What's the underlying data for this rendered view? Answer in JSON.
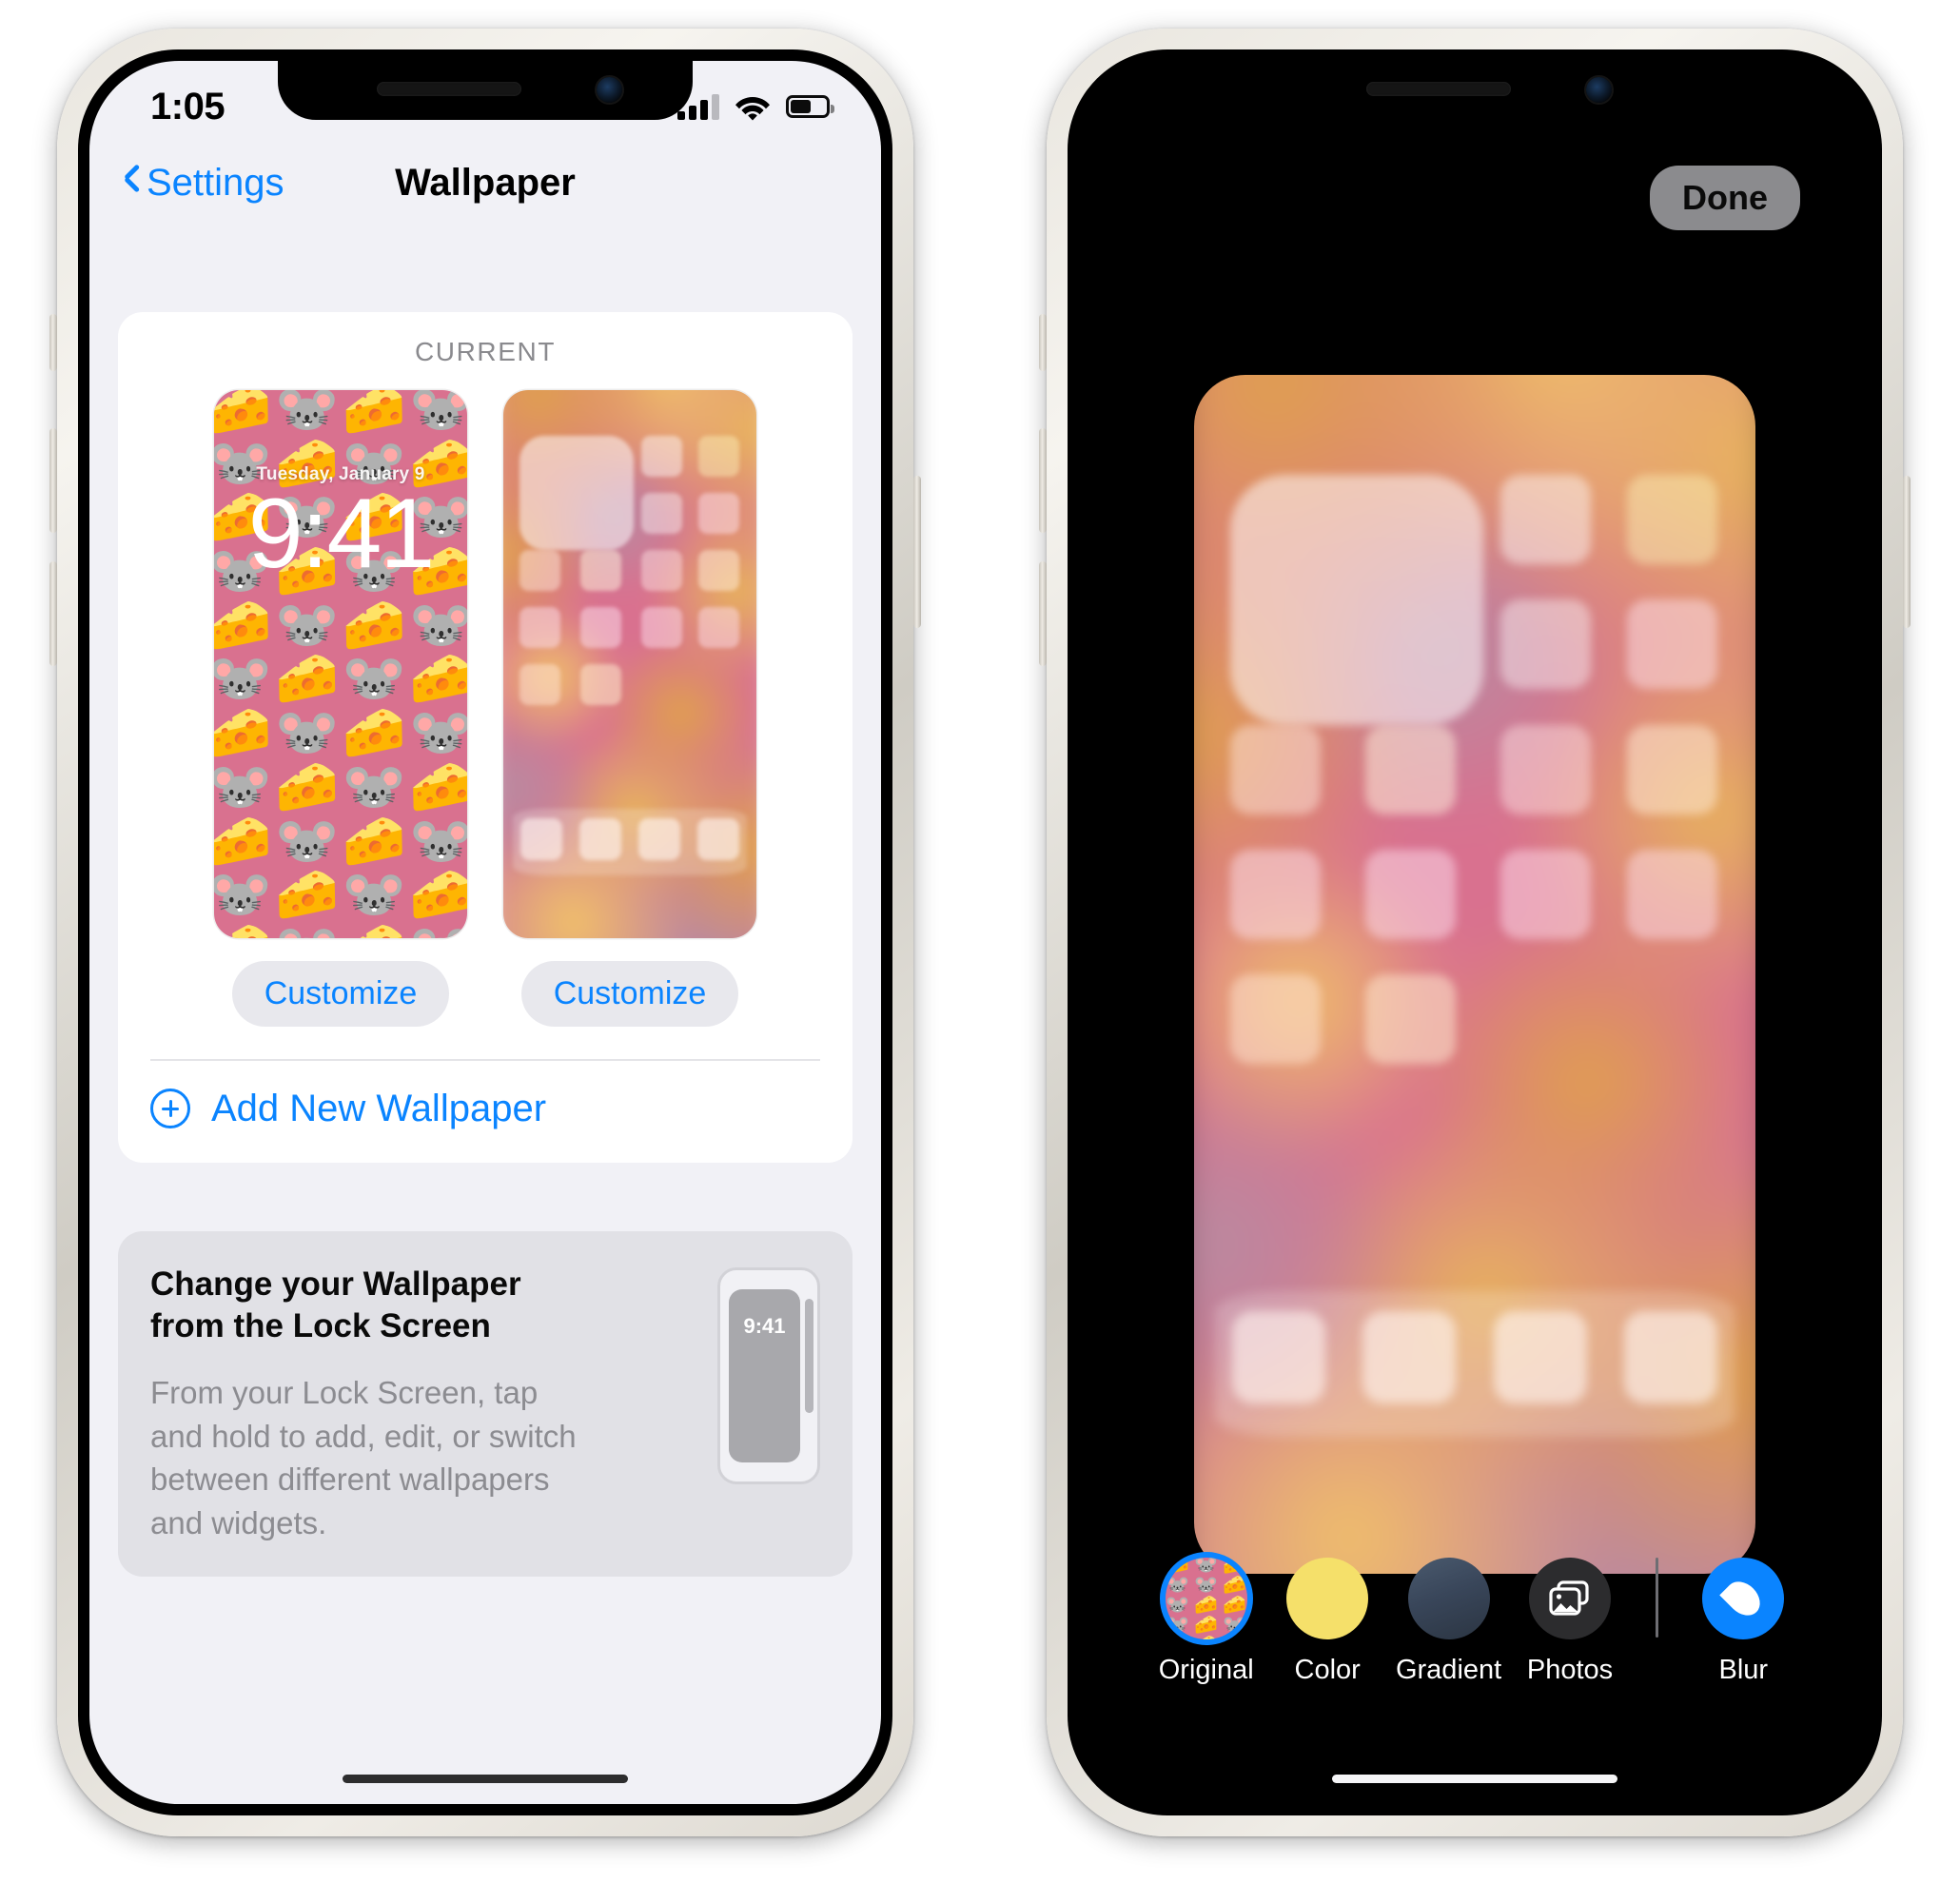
{
  "left_phone": {
    "status_bar": {
      "time": "1:05",
      "signal_icon": "cellular-bars-icon",
      "signal_bars_filled": 3,
      "signal_bars_total": 4,
      "wifi_icon": "wifi-icon",
      "battery_icon": "battery-icon",
      "battery_level_pct": 58
    },
    "nav": {
      "back_label": "Settings",
      "back_icon": "chevron-left-icon",
      "title": "Wallpaper"
    },
    "current_section": {
      "header": "CURRENT",
      "lock_preview": {
        "date": "Tuesday, January 9",
        "time": "9:41",
        "customize_label": "Customize"
      },
      "home_preview": {
        "customize_label": "Customize"
      }
    },
    "add_new": {
      "icon": "plus-circle-icon",
      "label": "Add New Wallpaper"
    },
    "info_card": {
      "title": "Change your Wallpaper from the Lock Screen",
      "body": "From your Lock Screen, tap and hold to add, edit, or switch between different wallpapers and widgets.",
      "mini_phone_time": "9:41"
    }
  },
  "right_phone": {
    "done_label": "Done",
    "toolbar": [
      {
        "label": "Original",
        "icon": "wallpaper-thumbnail-icon",
        "selected": true,
        "color": ""
      },
      {
        "label": "Color",
        "icon": "color-swatch-icon",
        "selected": false,
        "color": "#f5e06a"
      },
      {
        "label": "Gradient",
        "icon": "gradient-swatch-icon",
        "selected": false,
        "color": "#39465a"
      },
      {
        "label": "Photos",
        "icon": "photos-icon",
        "selected": false,
        "color": "#2c2c2e"
      },
      {
        "label": "Blur",
        "icon": "water-drop-icon",
        "selected": false,
        "color": "#0a84ff"
      }
    ],
    "separator": "toolbar-divider"
  },
  "wallpaper": {
    "name": "mice-and-cheese-emoji",
    "base_color": "#d9718f",
    "emoji_sequence": [
      "🧀",
      "🐭",
      "🧀",
      "🐭",
      "🐭",
      "🧀",
      "🐭",
      "🧀",
      "🧀",
      "🐭",
      "🧀",
      "🐭",
      "🐭",
      "🧀",
      "🐭",
      "🧀",
      "🧀",
      "🐭",
      "🧀",
      "🐭",
      "🐭",
      "🧀",
      "🐭",
      "🧀",
      "🧀",
      "🐭",
      "🧀",
      "🐭",
      "🐭",
      "🧀",
      "🐭",
      "🧀",
      "🧀",
      "🐭",
      "🧀",
      "🐭",
      "🐭",
      "🧀",
      "🐭",
      "🧀",
      "🧀",
      "🐭",
      "🧀",
      "🐭",
      "🐭",
      "🧀",
      "🐭",
      "🧀"
    ],
    "blur_accents": [
      "#e0a04f",
      "#d9718f",
      "#e8b45c",
      "#b98aa0",
      "#f0c06a"
    ]
  },
  "colors": {
    "accent_blue": "#0a84ff",
    "screen_bg": "#f1f1f6",
    "card_bg": "#ffffff",
    "info_card_bg": "#e1e1e6",
    "secondary_text": "#8a8a8e",
    "button_bg": "#e8e8ed",
    "done_bg": "#8b8b8e"
  }
}
